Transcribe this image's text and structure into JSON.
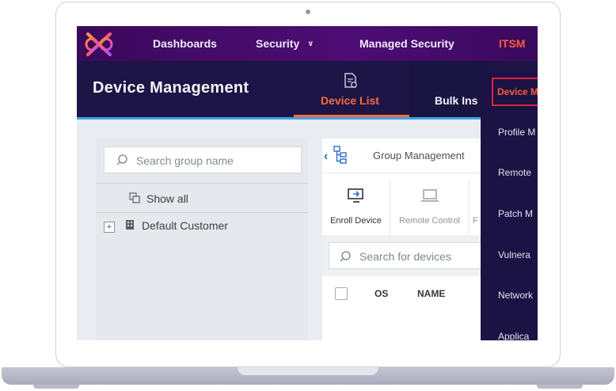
{
  "topnav": {
    "items": [
      {
        "label": "Dashboards"
      },
      {
        "label": "Security",
        "chevron": "chevron-down-icon"
      },
      {
        "label": "Managed Security"
      },
      {
        "label": "ITSM",
        "active": true
      }
    ]
  },
  "subheader": {
    "title": "Device Management",
    "tabs": [
      {
        "label": "Device List",
        "active": true,
        "icon": "device-list-icon"
      },
      {
        "label": "Bulk Ins"
      }
    ]
  },
  "dropdown_menu": {
    "items": [
      "Device M",
      "Profile M",
      "Remote",
      "Patch M",
      "Vulnera",
      "Network",
      "Applica"
    ]
  },
  "left_panel": {
    "search_placeholder": "Search group name",
    "show_all_label": "Show all",
    "customer_label": "Default Customer",
    "expand_symbol": "+"
  },
  "main_panel": {
    "group_management_label": "Group Management",
    "back_symbol": "‹",
    "actions": [
      {
        "label": "Enroll Device",
        "icon": "enroll-device-icon"
      },
      {
        "label": "Remote Control",
        "icon": "remote-control-icon"
      },
      {
        "label": "F"
      }
    ],
    "device_search_placeholder": "Search for devices",
    "table_columns": [
      "OS",
      "NAME"
    ]
  },
  "colors": {
    "nav_bg": "#4d0c74",
    "subheader_bg": "#1d1546",
    "accent": "#ff6a3d",
    "highlight_border": "#e0203a",
    "strip_blue": "#3da2e8"
  }
}
